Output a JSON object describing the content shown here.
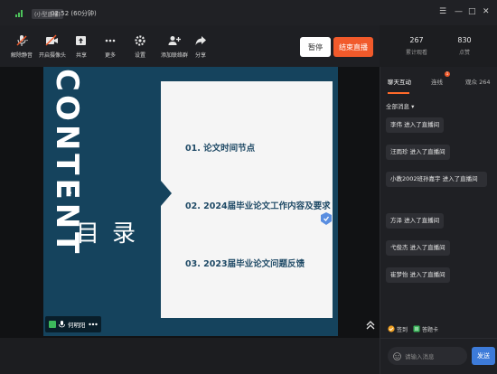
{
  "titlebar": {
    "badge": "(小型直播)",
    "time": "02:52 (60分钟)",
    "controls": [
      "☰",
      "—",
      "□",
      "✕"
    ]
  },
  "toolbar": {
    "items": [
      {
        "label": "解除静音",
        "icon": "mic-muted-icon"
      },
      {
        "label": "开启摄像头",
        "icon": "camera-off-icon"
      },
      {
        "label": "共享",
        "icon": "share-screen-icon"
      },
      {
        "label": "更多",
        "icon": "more-icon"
      },
      {
        "label": "设置",
        "icon": "gear-icon"
      },
      {
        "label": "添加联络群",
        "icon": "add-group-icon"
      },
      {
        "label": "分享",
        "icon": "share-icon"
      }
    ],
    "pause_label": "暂停",
    "end_label": "结束直播"
  },
  "stats": [
    {
      "value": "267",
      "caption": "累计观看"
    },
    {
      "value": "830",
      "caption": "点赞"
    }
  ],
  "slide": {
    "side_word": "CONTENT",
    "heading": "目录",
    "items": [
      "01. 论文时间节点",
      "02. 2024届毕业论文工作内容及要求",
      "03. 2023届毕业论文问题反馈"
    ]
  },
  "presenter": {
    "name": "何明阳"
  },
  "panel": {
    "tabs": [
      {
        "label": "聊天互动",
        "active": true
      },
      {
        "label": "连线",
        "badge": "1"
      },
      {
        "label": "观众 264"
      }
    ],
    "filter_label": "全部消息",
    "messages": [
      "李伟 进入了直播间",
      "汪雨珍 进入了直播间",
      "小教2002班孙嘉宇 进入了直播间",
      "方泽 进入了直播间",
      "弋俊杰 进入了直播间",
      "崔梦怡 进入了直播间"
    ],
    "tools": [
      {
        "label": "签到",
        "icon": "checkin-icon",
        "color": "#f0a020"
      },
      {
        "label": "答题卡",
        "icon": "answer-card-icon",
        "color": "#3cb85c"
      }
    ],
    "input_placeholder": "请输入消息",
    "send_label": "发送"
  },
  "colors": {
    "accent": "#f15a2b",
    "slide_bg": "#15435d",
    "send": "#3d7bd9"
  }
}
